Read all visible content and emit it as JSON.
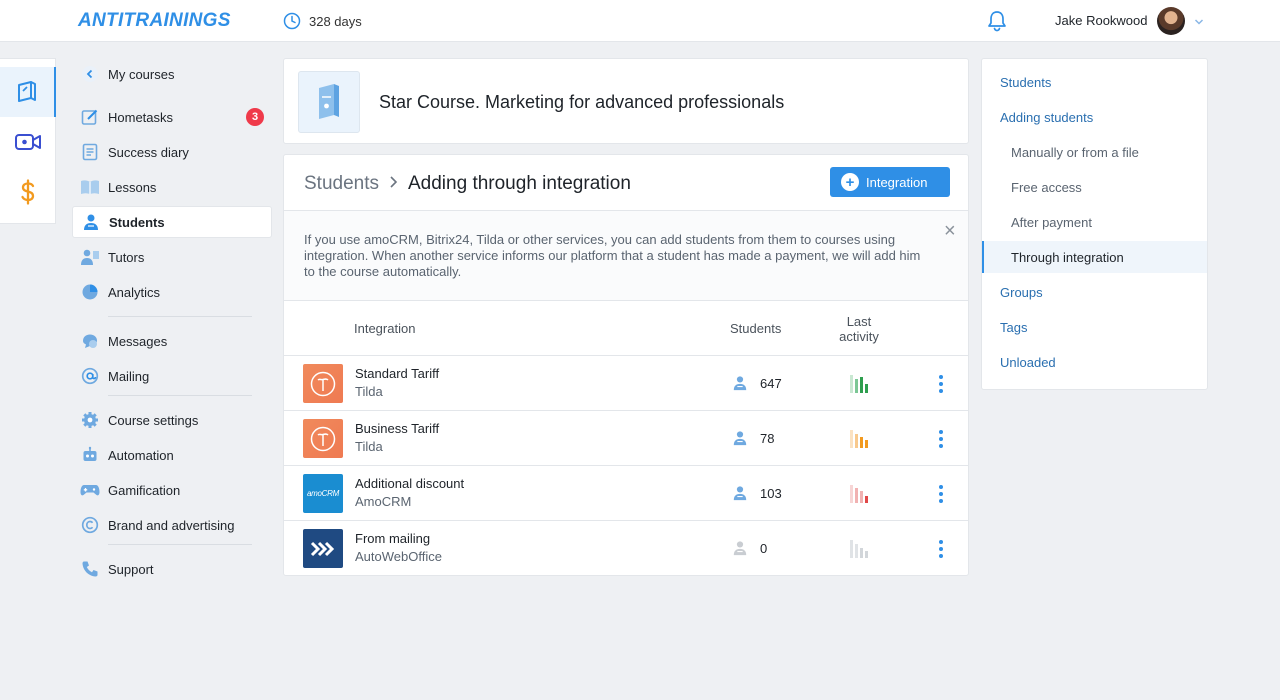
{
  "header": {
    "logo": "ANTITRAININGS",
    "days": "328 days",
    "user_name": "Jake Rookwood"
  },
  "nav": {
    "items": [
      {
        "label": "My courses"
      },
      {
        "label": "Hometasks",
        "badge": "3"
      },
      {
        "label": "Success diary"
      },
      {
        "label": "Lessons"
      },
      {
        "label": "Students"
      },
      {
        "label": "Tutors"
      },
      {
        "label": "Analytics"
      },
      {
        "label": "Messages"
      },
      {
        "label": "Mailing"
      },
      {
        "label": "Course settings"
      },
      {
        "label": "Automation"
      },
      {
        "label": "Gamification"
      },
      {
        "label": "Brand and advertising"
      },
      {
        "label": "Support"
      }
    ]
  },
  "course": {
    "title": "Star Course. Marketing for advanced professionals"
  },
  "panel": {
    "breadcrumb_parent": "Students",
    "breadcrumb_current": "Adding through integration",
    "add_button": "Integration",
    "info": "If you use amoCRM, Bitrix24, Tilda or other services, you can add students from them to courses using integration. When another service informs our platform that a student has made a payment, we will add him to the course automatically.",
    "columns": {
      "integration": "Integration",
      "students": "Students",
      "last_activity": "Last activity"
    },
    "rows": [
      {
        "name": "Standard Tariff",
        "source": "Tilda",
        "students": "647",
        "activity_color": "#2e9e4e",
        "logo_color": "#f0855a"
      },
      {
        "name": "Business Tariff",
        "source": "Tilda",
        "students": "78",
        "activity_color": "#f29a1f",
        "logo_color": "#f0855a"
      },
      {
        "name": "Additional discount",
        "source": "AmoCRM",
        "students": "103",
        "activity_color": "#e04848",
        "logo_color": "#1a8dd1",
        "logo_text": "amoCRM"
      },
      {
        "name": "From mailing",
        "source": "AutoWebOffice",
        "students": "0",
        "activity_color": "#c9cdd2",
        "logo_color": "#1f4a82"
      }
    ]
  },
  "right_menu": {
    "items": [
      {
        "label": "Students"
      },
      {
        "label": "Adding students"
      },
      {
        "label": "Manually or from a file"
      },
      {
        "label": "Free access"
      },
      {
        "label": "After payment"
      },
      {
        "label": "Through integration"
      },
      {
        "label": "Groups"
      },
      {
        "label": "Tags"
      },
      {
        "label": "Unloaded"
      }
    ]
  },
  "colors": {
    "accent": "#2f8fe6",
    "badge": "#ef3a4a",
    "rail_money": "#f29a1f",
    "rail_video": "#3a4fd1"
  }
}
